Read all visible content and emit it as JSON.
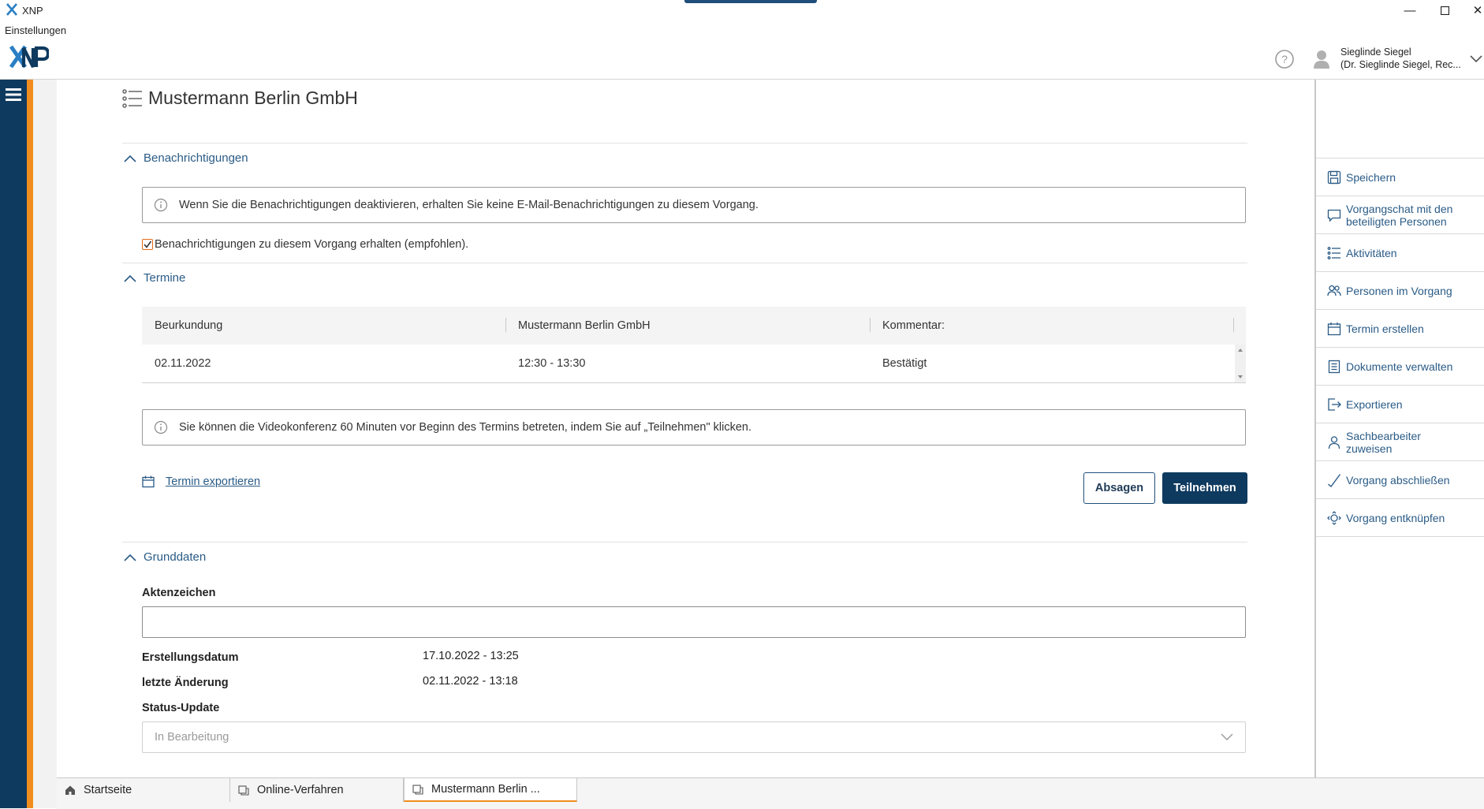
{
  "window": {
    "app_title": "XNP",
    "menu_settings": "Einstellungen"
  },
  "user": {
    "name": "Sieglinde Siegel",
    "role": "(Dr. Sieglinde Siegel, Rec..."
  },
  "page": {
    "title": "Mustermann Berlin GmbH"
  },
  "notifications": {
    "header": "Benachrichtigungen",
    "info": "Wenn Sie die Benachrichtigungen deaktivieren, erhalten Sie keine E-Mail-Benachrichtigungen zu diesem Vorgang.",
    "checkbox_label": "Benachrichtigungen zu diesem Vorgang erhalten (empfohlen).",
    "checkbox_checked": true
  },
  "appointments": {
    "header": "Termine",
    "columns": [
      "Beurkundung",
      "Mustermann Berlin GmbH",
      "Kommentar:"
    ],
    "rows": [
      [
        "02.11.2022",
        "12:30 - 13:30",
        "Bestätigt"
      ]
    ],
    "video_info": "Sie können die Videokonferenz 60 Minuten vor Beginn des Termins betreten, indem Sie auf „Teilnehmen\" klicken.",
    "export_link": "Termin exportieren",
    "decline_button": "Absagen",
    "join_button": "Teilnehmen"
  },
  "basic_data": {
    "header": "Grunddaten",
    "file_number_label": "Aktenzeichen",
    "file_number_value": "",
    "created_label": "Erstellungsdatum",
    "created_value": "17.10.2022 - 13:25",
    "modified_label": "letzte Änderung",
    "modified_value": "02.11.2022 - 13:18",
    "status_label": "Status-Update",
    "status_value": "In Bearbeitung"
  },
  "actions": [
    {
      "label": "Speichern",
      "icon": "save-icon"
    },
    {
      "label": "Vorgangschat mit den beteiligten Personen",
      "icon": "chat-icon"
    },
    {
      "label": "Aktivitäten",
      "icon": "list-icon"
    },
    {
      "label": "Personen im Vorgang",
      "icon": "people-icon"
    },
    {
      "label": "Termin erstellen",
      "icon": "calendar-icon"
    },
    {
      "label": "Dokumente verwalten",
      "icon": "document-icon"
    },
    {
      "label": "Exportieren",
      "icon": "export-icon"
    },
    {
      "label": "Sachbearbeiter zuweisen",
      "icon": "person-icon"
    },
    {
      "label": "Vorgang abschließen",
      "icon": "check-icon"
    },
    {
      "label": "Vorgang entknüpfen",
      "icon": "unlink-icon"
    }
  ],
  "tabs": [
    {
      "label": "Startseite",
      "icon": "home-icon"
    },
    {
      "label": "Online-Verfahren",
      "icon": "folder-icon"
    },
    {
      "label": "Mustermann Berlin ...",
      "icon": "folder-icon",
      "active": true
    }
  ],
  "colors": {
    "primary": "#0e3a5f",
    "accent": "#f18d1e",
    "link": "#2a5b86"
  }
}
